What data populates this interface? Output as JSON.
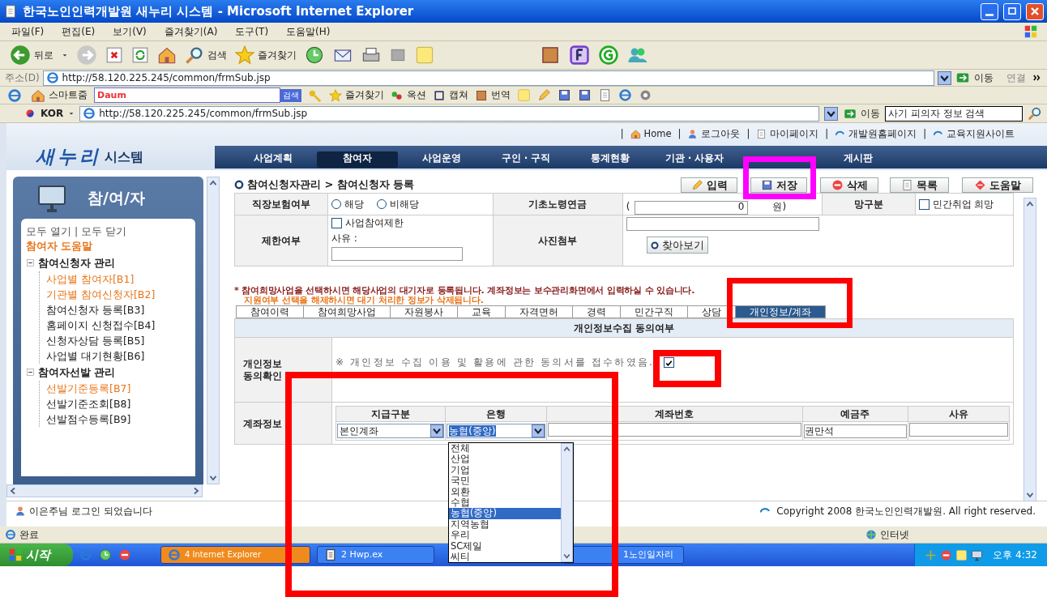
{
  "window": {
    "title": "한국노인인력개발원 새누리 시스템 - Microsoft Internet Explorer",
    "menu": [
      "파일(F)",
      "편집(E)",
      "보기(V)",
      "즐겨찾기(A)",
      "도구(T)",
      "도움말(H)"
    ],
    "toolbar": {
      "back": "뒤로",
      "search": "검색",
      "favorites": "즐겨찾기"
    },
    "address": {
      "label": "주소(D)",
      "url": "http://58.120.225.245/common/frmSub.jsp",
      "go": "이동",
      "links": "연결"
    },
    "links_bar": {
      "smartzoom": "스마트줌",
      "engine": "Daum",
      "search_button": "검색",
      "items": [
        "즐겨찾기",
        "옥션",
        "캡쳐",
        "번역"
      ]
    },
    "second_bar": {
      "language": "KOR",
      "url": "http://58.120.225.245/common/frmSub.jsp",
      "go": "이동",
      "search_value": "사기 피의자 정보 검색"
    }
  },
  "page": {
    "link_separator": "|",
    "top_links": [
      "Home",
      "로그아웃",
      "마이페이지",
      "개발원홈페이지",
      "교육지원사이트"
    ],
    "logo": {
      "text": "새누리",
      "suffix": "시스템"
    },
    "nav": [
      {
        "label": "사업계획",
        "selected": false
      },
      {
        "label": "참여자",
        "selected": true
      },
      {
        "label": "사업운영",
        "selected": false
      },
      {
        "label": "구인 · 구직",
        "selected": false
      },
      {
        "label": "통계현황",
        "selected": false
      },
      {
        "label": "기관 · 사용자",
        "selected": false
      },
      {
        "label": "게시판",
        "selected": false
      }
    ],
    "sidebar": {
      "title": "참/여/자",
      "open_all": "모두 열기",
      "separator": "|",
      "close_all": "모두 닫기",
      "tree": [
        {
          "label": "참여자 도움말",
          "highlighted": true
        },
        {
          "label": "참여신청자 관리",
          "highlighted": false,
          "expanded": true,
          "children": [
            {
              "label": "사업별 참여자[B1]",
              "highlighted": true
            },
            {
              "label": "기관별 참여신청자[B2]",
              "highlighted": true
            },
            {
              "label": "참여신청자 등록[B3]",
              "highlighted": false
            },
            {
              "label": "홈페이지 신청접수[B4]",
              "highlighted": false
            },
            {
              "label": "신청자상담 등록[B5]",
              "highlighted": false
            },
            {
              "label": "사업별 대기현황[B6]",
              "highlighted": false
            }
          ]
        },
        {
          "label": "참여자선발 관리",
          "highlighted": false,
          "expanded": true,
          "children": [
            {
              "label": "선발기준등록[B7]",
              "highlighted": true
            },
            {
              "label": "선발기준조회[B8]",
              "highlighted": false
            },
            {
              "label": "선발점수등록[B9]",
              "highlighted": false
            }
          ]
        }
      ]
    },
    "breadcrumb": "참여신청자관리 > 참여신청자 등록",
    "actions": [
      "입력",
      "저장",
      "삭제",
      "목록",
      "도움말"
    ],
    "form": {
      "insurance": {
        "label": "직장보험여부",
        "options": [
          {
            "label": "해당",
            "selected": false
          },
          {
            "label": "비해당",
            "selected": false
          }
        ]
      },
      "pension": {
        "label": "기초노령연금",
        "open_paren": "(",
        "amount": "0",
        "unit": "원)"
      },
      "hope": {
        "label": "망구분",
        "option": "민간취업 희망",
        "checked": false
      },
      "restriction": {
        "label": "제한여부",
        "option": "사업참여제한",
        "checked": false,
        "reason_label": "사유 :"
      },
      "photo": {
        "label": "사진첨부",
        "browse": "찾아보기"
      }
    },
    "notices": [
      {
        "kind": "info",
        "text": "* 참여희망사업을 선택하시면 해당사업의 대기자로 등록됩니다. 계좌정보는 보수관리화면에서 입력하실 수 있습니다."
      },
      {
        "kind": "warning",
        "text": "지원여부 선택을 해제하시면 대기 처리한 정보가 삭제됩니다."
      }
    ],
    "tabs": [
      {
        "label": "참여이력",
        "selected": false
      },
      {
        "label": "참여희망사업",
        "selected": false
      },
      {
        "label": "자원봉사",
        "selected": false
      },
      {
        "label": "교육",
        "selected": false
      },
      {
        "label": "자격면허",
        "selected": false
      },
      {
        "label": "경력",
        "selected": false
      },
      {
        "label": "민간구직",
        "selected": false
      },
      {
        "label": "상담",
        "selected": false
      },
      {
        "label": "개인정보/계좌",
        "selected": true
      }
    ],
    "consent": {
      "title": "개인정보수집 동의여부",
      "label": "개인정보 동의확인",
      "text": "※ 개인정보 수집 이용 및 활용에 관한 동의서를 접수하였음.",
      "checked": true
    },
    "account": {
      "label": "계좌정보",
      "columns": [
        "지급구분",
        "은행",
        "계좌번호",
        "예금주",
        "사유"
      ],
      "payment": "본인계좌",
      "bank": "농협(중앙)",
      "holder": "권만석"
    },
    "bank_dropdown": {
      "expanded": true,
      "options": [
        {
          "label": "전체",
          "selected": false
        },
        {
          "label": "산업",
          "selected": false
        },
        {
          "label": "기업",
          "selected": false
        },
        {
          "label": "국민",
          "selected": false
        },
        {
          "label": "외환",
          "selected": false
        },
        {
          "label": "수협",
          "selected": false
        },
        {
          "label": "농협(중앙)",
          "selected": true
        },
        {
          "label": "지역농협",
          "selected": false
        },
        {
          "label": "우리",
          "selected": false
        },
        {
          "label": "SC제일",
          "selected": false
        },
        {
          "label": "씨티",
          "selected": false
        }
      ]
    },
    "login_status": "이은주님 로그인 되었습니다",
    "copyright": "Copyright 2008 한국노인인력개발원. All right reserved."
  },
  "status_bar": {
    "text": "완료",
    "zone": "인터넷"
  },
  "taskbar": {
    "start": "시작",
    "tasks": [
      {
        "label": "4 Internet Explorer",
        "active": true
      },
      {
        "label": "2 Hwp.ex",
        "active": false
      },
      {
        "label": "1노인일자리",
        "active": false
      }
    ],
    "clock": "오후 4:32"
  },
  "annotations": [
    {
      "color": "#ff00ff"
    },
    {
      "color": "#ff0000"
    },
    {
      "color": "#ff0000"
    },
    {
      "color": "#ff0000"
    }
  ]
}
